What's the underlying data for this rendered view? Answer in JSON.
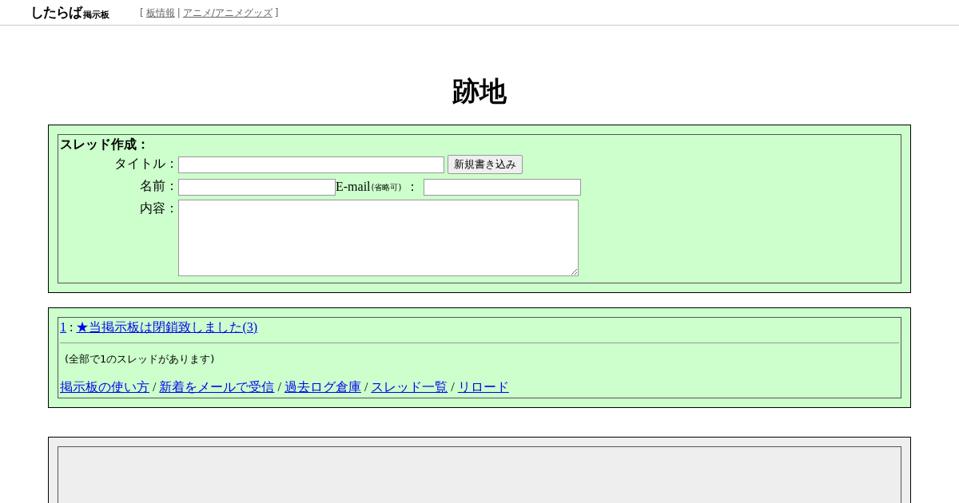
{
  "header": {
    "logo": {
      "main": "したらば",
      "sub": "掲示板"
    },
    "open_bracket": "[",
    "links": [
      {
        "label": "板情報"
      },
      {
        "label": "アニメ/アニメグッズ"
      }
    ],
    "separator": "|",
    "close_bracket": "]"
  },
  "board_title": "跡地",
  "thread_form": {
    "heading": "スレッド作成：",
    "title_label": "タイトル：",
    "submit": "新規書き込み",
    "name_label": "名前：",
    "email_label": "E-mail",
    "email_note": "(省略可)",
    "email_colon": "：",
    "content_label": "内容："
  },
  "threads": [
    {
      "number": "1",
      "separator": ":",
      "title": "★当掲示板は閉鎖致しました(3)"
    }
  ],
  "thread_count": "(全部で1のスレッドがあります)",
  "footer_links": [
    {
      "label": "掲示板の使い方"
    },
    {
      "label": "新着をメールで受信"
    },
    {
      "label": "過去ログ倉庫"
    },
    {
      "label": "スレッド一覧"
    },
    {
      "label": "リロード"
    }
  ],
  "footer_separator": "/"
}
